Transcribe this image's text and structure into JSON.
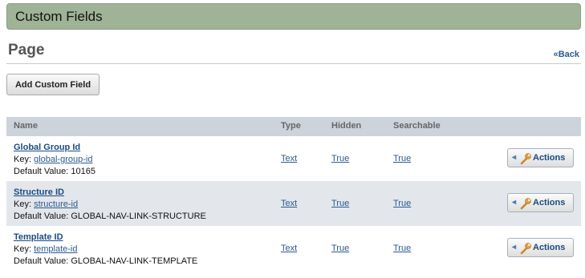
{
  "panel": {
    "title": "Custom Fields"
  },
  "page": {
    "title": "Page",
    "back_label": "«Back"
  },
  "toolbar": {
    "add_label": "Add Custom Field"
  },
  "table": {
    "headers": {
      "name": "Name",
      "type": "Type",
      "hidden": "Hidden",
      "searchable": "Searchable"
    },
    "key_prefix": "Key:",
    "default_prefix": "Default Value:",
    "rows": [
      {
        "name": "Global Group Id",
        "key": "global-group-id",
        "default_value": "10165",
        "type": "Text",
        "hidden": "True",
        "searchable": "True",
        "actions_label": "Actions"
      },
      {
        "name": "Structure ID",
        "key": "structure-id",
        "default_value": "GLOBAL-NAV-LINK-STRUCTURE",
        "type": "Text",
        "hidden": "True",
        "searchable": "True",
        "actions_label": "Actions"
      },
      {
        "name": "Template ID",
        "key": "template-id",
        "default_value": "GLOBAL-NAV-LINK-TEMPLATE",
        "type": "Text",
        "hidden": "True",
        "searchable": "True",
        "actions_label": "Actions"
      }
    ]
  },
  "colors": {
    "header_bar": "#9fb396",
    "table_header": "#cdd3db",
    "alt_row": "#e3e7ec",
    "link": "#2b5a8a"
  },
  "icons": {
    "actions": "wrench-icon",
    "menu_arrow": "chevron-left-icon"
  }
}
